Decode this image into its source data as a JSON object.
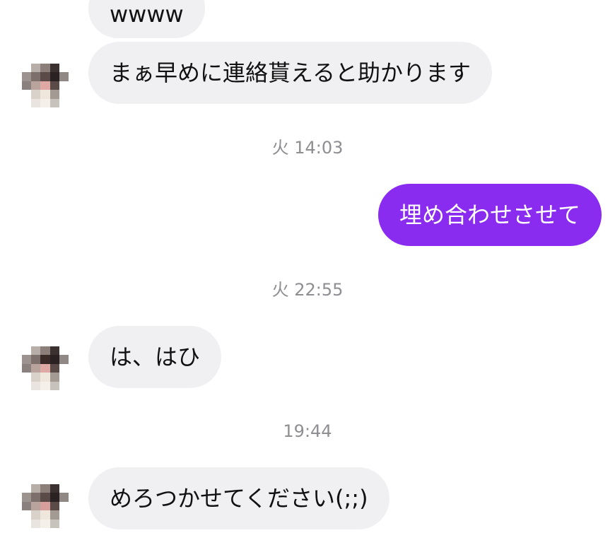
{
  "messages": [
    {
      "type": "incoming",
      "text": "wwww",
      "avatar": false
    },
    {
      "type": "incoming",
      "text": "まぁ早めに連絡貰えると助かります",
      "avatar": true
    },
    {
      "type": "timestamp",
      "text": "火 14:03"
    },
    {
      "type": "outgoing",
      "text": "埋め合わせさせて"
    },
    {
      "type": "timestamp",
      "text": "火 22:55"
    },
    {
      "type": "incoming",
      "text": "は、はひ",
      "avatar": true
    },
    {
      "type": "timestamp",
      "text": "19:44"
    },
    {
      "type": "incoming",
      "text": "めろつかせてください(;;)",
      "avatar": true
    }
  ],
  "colors": {
    "outgoing_bubble": "#8a2cf0",
    "incoming_bubble": "#f0f0f3",
    "timestamp": "#8e8e93"
  }
}
